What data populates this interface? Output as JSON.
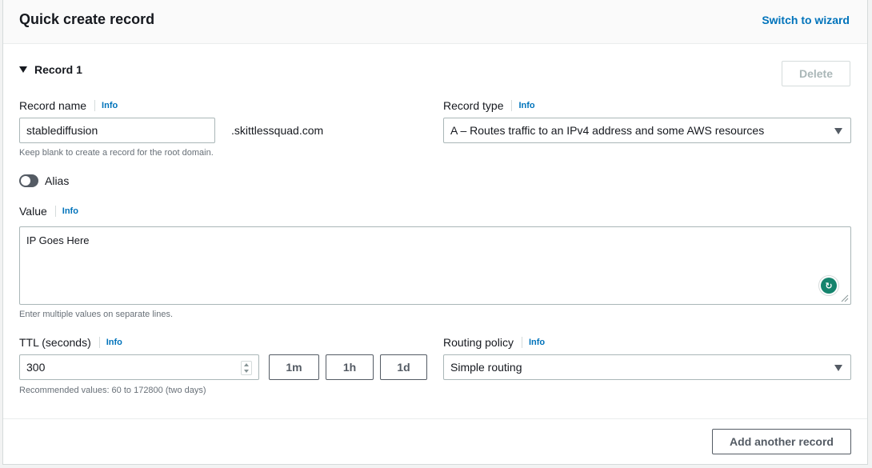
{
  "header": {
    "title": "Quick create record",
    "switch_link": "Switch to wizard"
  },
  "record": {
    "title": "Record 1",
    "delete_label": "Delete"
  },
  "record_name": {
    "label": "Record name",
    "info": "Info",
    "value": "stablediffusion",
    "domain_suffix": ".skittlessquad.com",
    "hint": "Keep blank to create a record for the root domain."
  },
  "record_type": {
    "label": "Record type",
    "info": "Info",
    "selected": "A – Routes traffic to an IPv4 address and some AWS resources"
  },
  "alias": {
    "label": "Alias",
    "enabled": false
  },
  "value_field": {
    "label": "Value",
    "info": "Info",
    "value": "IP Goes Here",
    "hint": "Enter multiple values on separate lines."
  },
  "ttl": {
    "label": "TTL (seconds)",
    "info": "Info",
    "value": "300",
    "hint": "Recommended values: 60 to 172800 (two days)",
    "presets": [
      "1m",
      "1h",
      "1d"
    ]
  },
  "routing_policy": {
    "label": "Routing policy",
    "info": "Info",
    "selected": "Simple routing"
  },
  "footer": {
    "add_label": "Add another record"
  },
  "icons": {
    "caret": "caret-down-icon",
    "select": "dropdown-arrow-icon",
    "grammar": "grammarly-icon",
    "resize": "resize-handle-icon"
  },
  "colors": {
    "link": "#0073bb",
    "text": "#16191f",
    "hint": "#687078",
    "border": "#aab7b8",
    "toggle_off": "#545b64"
  }
}
